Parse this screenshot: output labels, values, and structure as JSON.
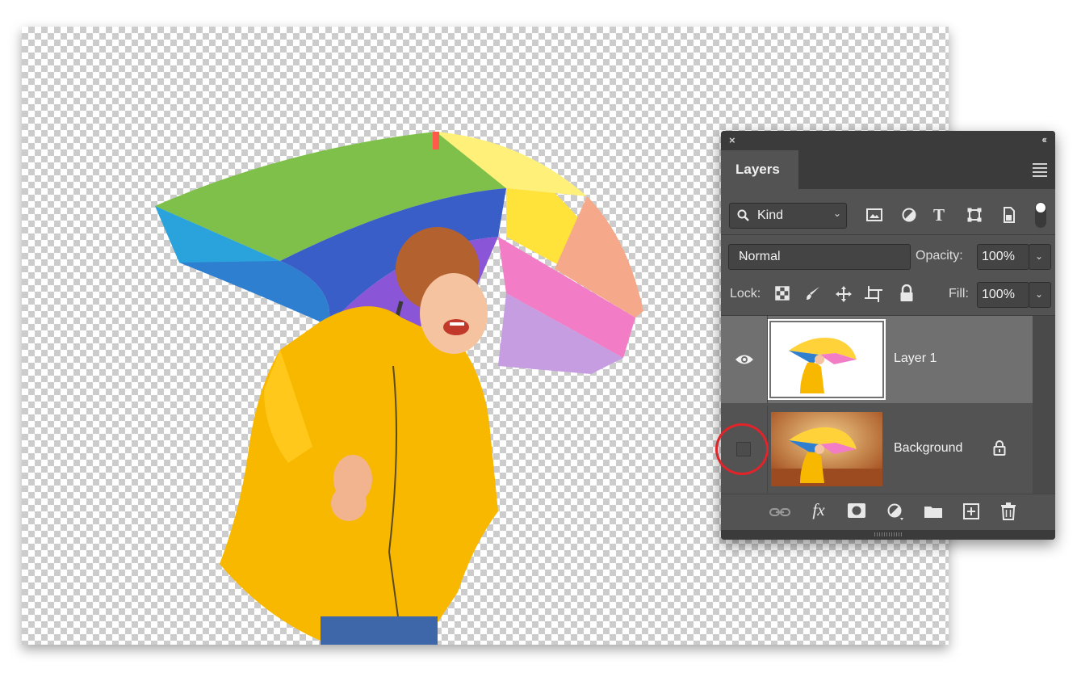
{
  "panel": {
    "close_glyph": "×",
    "collapse_glyph": "‹‹",
    "tab": "Layers",
    "menu_icon": "hamburger-menu-icon"
  },
  "filter": {
    "kind_label": "Kind",
    "icons": [
      "pixel-filter-icon",
      "adjustment-filter-icon",
      "type-filter-icon",
      "shape-filter-icon",
      "smart-object-filter-icon",
      "filter-toggle-icon"
    ]
  },
  "blend": {
    "mode": "Normal",
    "opacity_label": "Opacity:",
    "opacity_value": "100%"
  },
  "lock": {
    "label": "Lock:",
    "icons": [
      "lock-transparent-pixels-icon",
      "lock-image-pixels-icon",
      "lock-position-icon",
      "lock-artboard-icon",
      "lock-all-icon"
    ],
    "fill_label": "Fill:",
    "fill_value": "100%"
  },
  "layers": [
    {
      "name": "Layer 1",
      "visible": true,
      "selected": true,
      "locked": false
    },
    {
      "name": "Background",
      "visible": false,
      "selected": false,
      "locked": true
    }
  ],
  "footer_icons": [
    "link-layers-icon",
    "layer-style-fx-icon",
    "add-mask-icon",
    "new-adjustment-layer-icon",
    "new-group-icon",
    "new-layer-icon",
    "delete-layer-icon"
  ],
  "colors": {
    "panel_bg": "#535353",
    "selected_row": "#707070",
    "highlight_circle": "#e0242a",
    "raincoat": "#f9b800"
  }
}
